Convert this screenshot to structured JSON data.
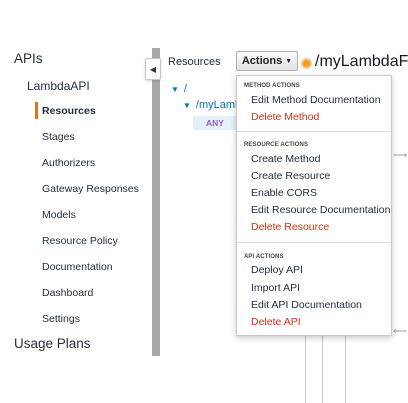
{
  "nav": {
    "apis": "APIs",
    "api_name": "LambdaAPI",
    "items": [
      {
        "label": "Resources",
        "active": true
      },
      {
        "label": "Stages"
      },
      {
        "label": "Authorizers"
      },
      {
        "label": "Gateway Responses"
      },
      {
        "label": "Models"
      },
      {
        "label": "Resource Policy"
      },
      {
        "label": "Documentation"
      },
      {
        "label": "Dashboard"
      },
      {
        "label": "Settings"
      }
    ],
    "usage_plans": "Usage Plans"
  },
  "main": {
    "resources_title": "Resources",
    "tree": {
      "root": "/",
      "resource": "/myLamb",
      "method": "ANY"
    },
    "path_title": "/myLambdaFu"
  },
  "actions": {
    "label": "Actions",
    "menu": {
      "method_header": "METHOD ACTIONS",
      "method_items": [
        "Edit Method Documentation",
        "Delete Method"
      ],
      "resource_header": "RESOURCE ACTIONS",
      "resource_items": [
        "Create Method",
        "Create Resource",
        "Enable CORS",
        "Edit Resource Documentation",
        "Delete Resource"
      ],
      "api_header": "API ACTIONS",
      "api_items": [
        "Deploy API",
        "Import API",
        "Edit API Documentation",
        "Delete API"
      ]
    }
  },
  "colors": {
    "accent": "#ec7211",
    "link": "#0073bb",
    "danger": "#d13212",
    "method_badge": "#9a5fb5"
  }
}
